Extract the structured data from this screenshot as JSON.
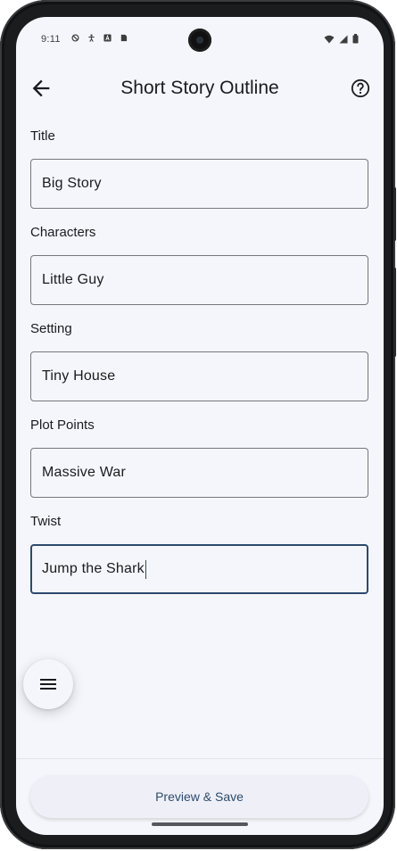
{
  "status_bar": {
    "time": "9:11",
    "left_icons": [
      "block-icon",
      "accessibility-icon",
      "app-a-icon",
      "sim-icon"
    ],
    "right_icons": [
      "wifi-icon",
      "signal-icon",
      "battery-icon"
    ]
  },
  "appbar": {
    "title": "Short Story Outline",
    "back_icon": "arrow-back-icon",
    "help_icon": "help-circle-icon"
  },
  "form": {
    "fields": [
      {
        "label": "Title",
        "value": "Big Story"
      },
      {
        "label": "Characters",
        "value": "Little Guy"
      },
      {
        "label": "Setting",
        "value": "Tiny House"
      },
      {
        "label": "Plot Points",
        "value": "Massive War"
      },
      {
        "label": "Twist",
        "value": "Jump the Shark"
      }
    ],
    "focused_field": "Twist"
  },
  "fab": {
    "icon": "menu-icon"
  },
  "bottom": {
    "button_label": "Preview & Save"
  },
  "colors": {
    "background": "#f5f6fb",
    "accent": "#2c4a6d",
    "text": "#1b1b1f",
    "outline": "#74777f"
  }
}
